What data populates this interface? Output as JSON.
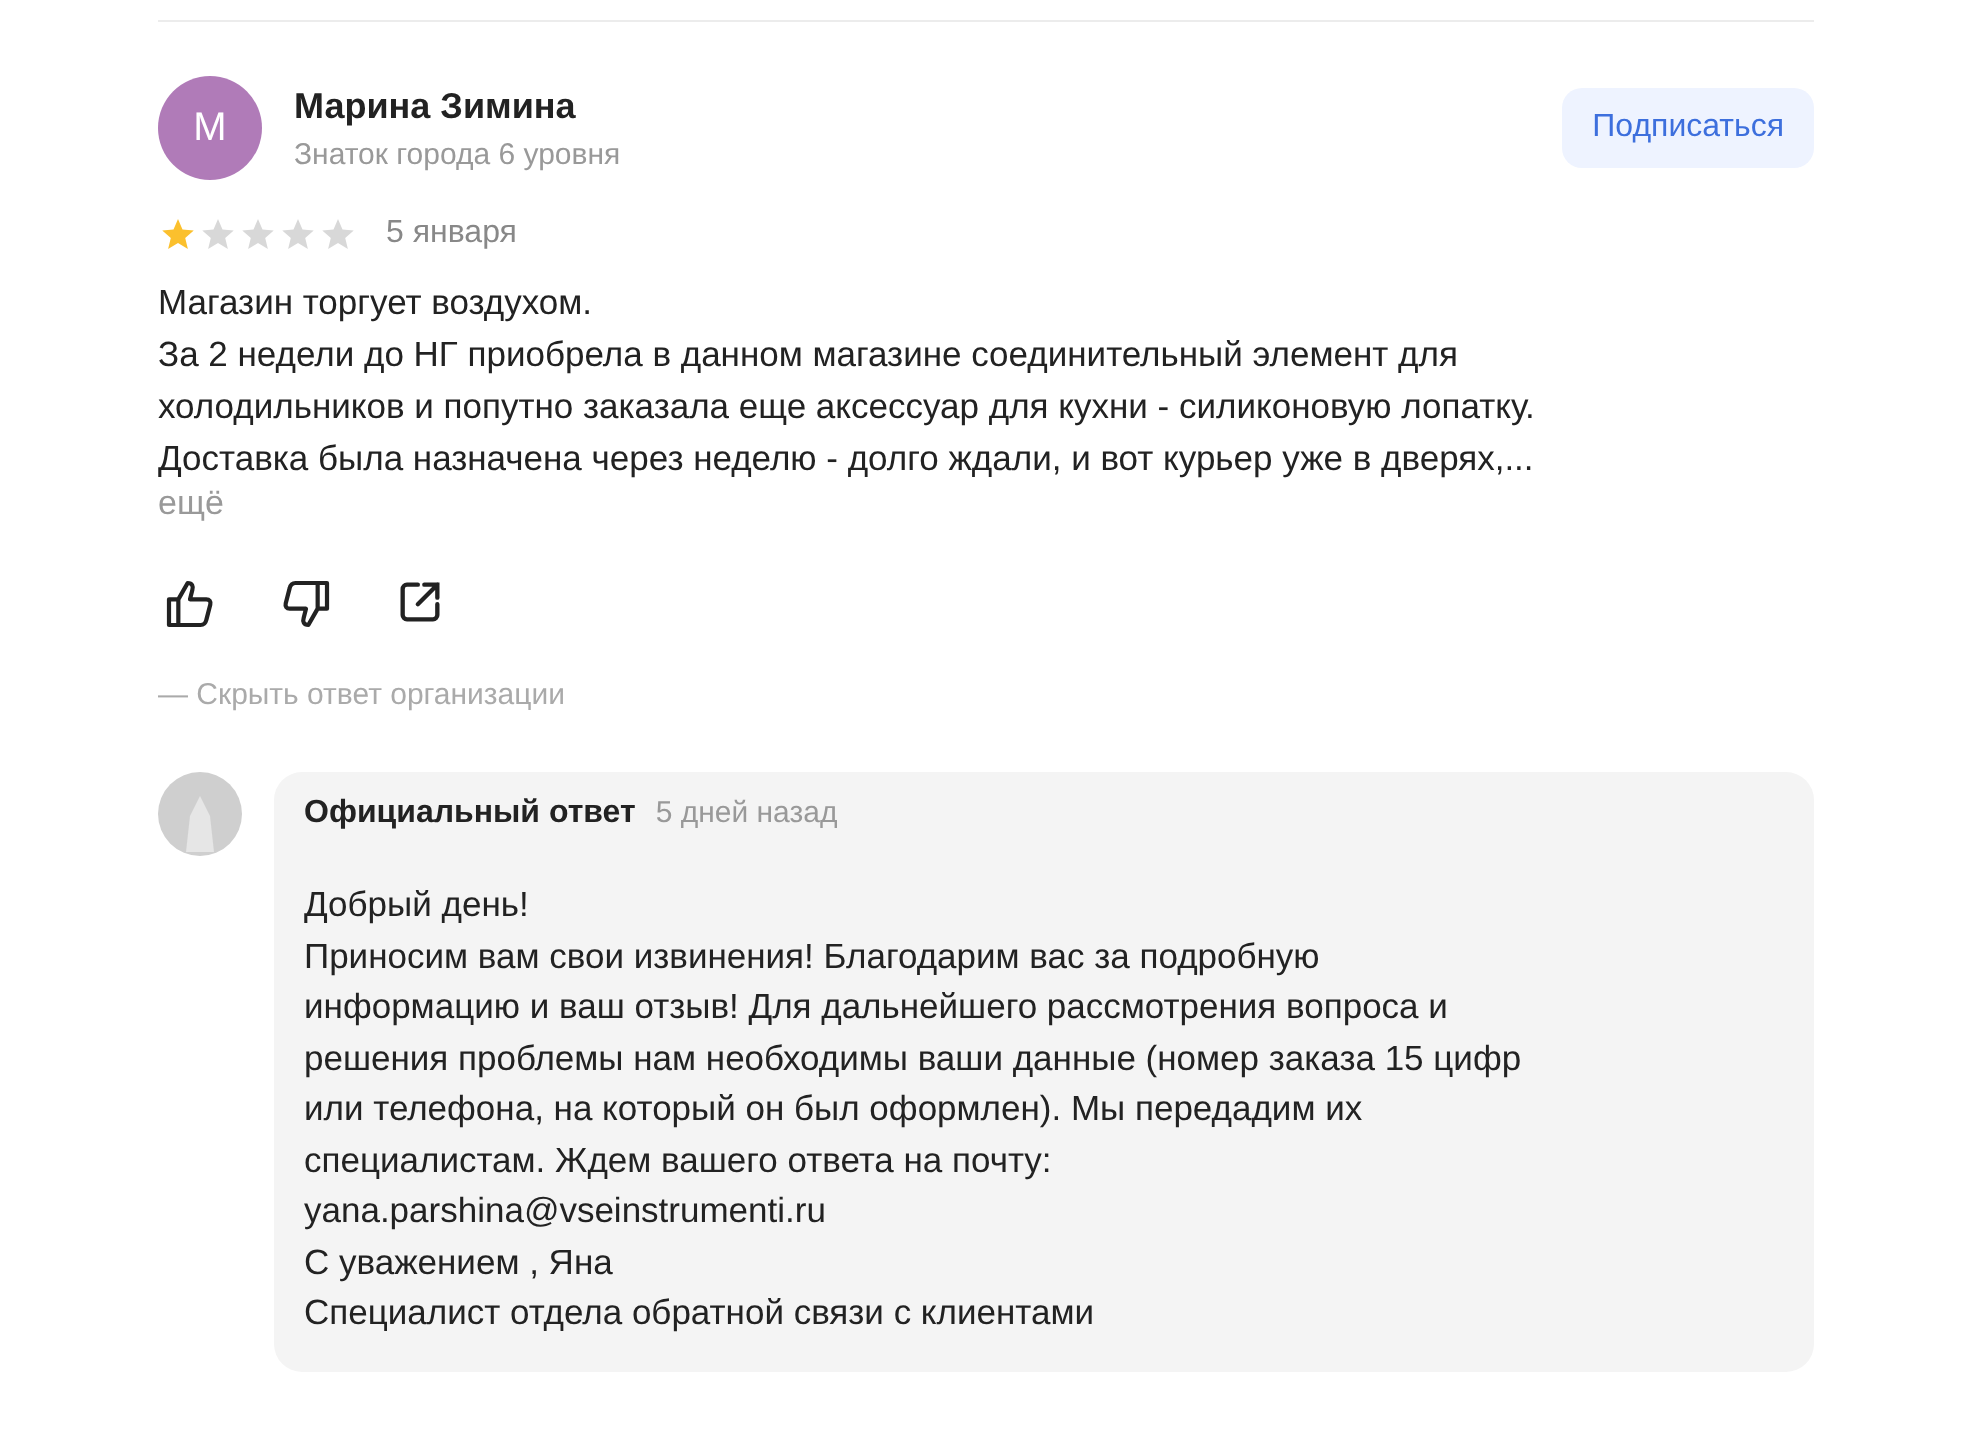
{
  "review": {
    "author": {
      "initial": "М",
      "name": "Марина Зимина",
      "level": "Знаток города 6 уровня"
    },
    "subscribe_button": "Подписаться",
    "stars": 1,
    "date": "5 января",
    "text": "Магазин торгует воздухом.\nЗа 2 недели до НГ приобрела в данном магазине соединительный элемент для\nхолодильников и попутно заказала еще аксессуар для кухни - силиконовую лопатку.\nДоставка была назначена через неделю - долго ждали, и вот курьер уже в дверях,...",
    "more_link": "ещё",
    "hide_reply_link": "— Скрыть ответ организации"
  },
  "reply": {
    "title": "Официальный ответ",
    "time": "5 дней назад",
    "text": "Добрый день!\nПриносим вам свои извинения! Благодарим вас за подробную\nинформацию и ваш отзыв! Для дальнейшего рассмотрения вопроса и\nрешения проблемы нам необходимы ваши данные (номер заказа 15 цифр\nили телефона, на который он был оформлен). Мы передадим их\nспециалистам. Ждем вашего ответа на почту:\nyana.parshina@vseinstrumenti.ru\nС уважением , Яна\nСпециалист отдела обратной связи с клиентами"
  }
}
